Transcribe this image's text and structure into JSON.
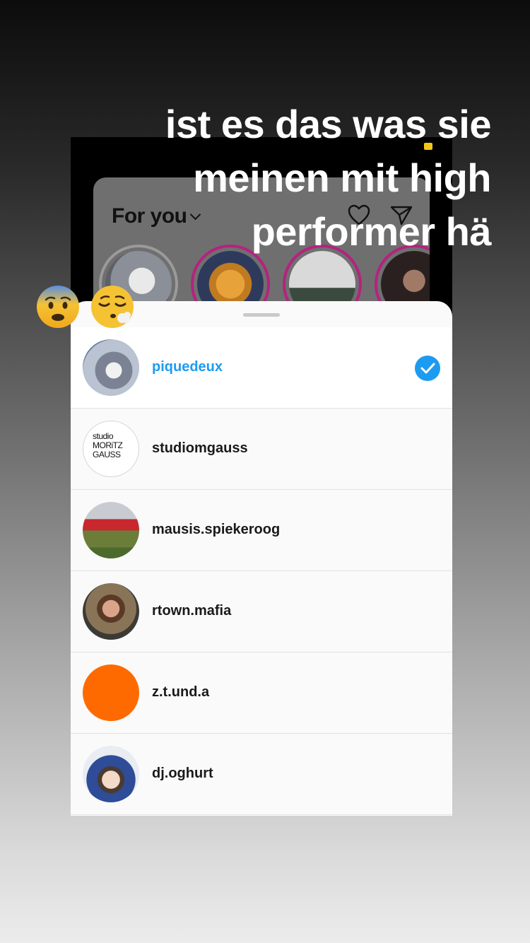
{
  "caption": {
    "lines": [
      "ist es das was sie",
      "meinen mit high",
      "performer hä"
    ]
  },
  "screenshot": {
    "feed": {
      "title": "For you"
    },
    "accounts": [
      {
        "username": "piquedeux",
        "selected": true
      },
      {
        "username": "studiomgauss",
        "selected": false,
        "avatar_text": [
          "studio",
          "MORiTZ",
          "GAUSS"
        ]
      },
      {
        "username": "mausis.spiekeroog",
        "selected": false
      },
      {
        "username": "rtown.mafia",
        "selected": false
      },
      {
        "username": "z.t.und.a",
        "selected": false
      },
      {
        "username": "dj.oghurt",
        "selected": false
      }
    ]
  },
  "stickers": [
    {
      "name": "fearful-face-emoji"
    },
    {
      "name": "exhaling-face-emoji"
    }
  ],
  "colors": {
    "selected_accent": "#1d9bf0",
    "notch_dot": "#f5c518",
    "avatar_orange": "#ff6a00"
  }
}
